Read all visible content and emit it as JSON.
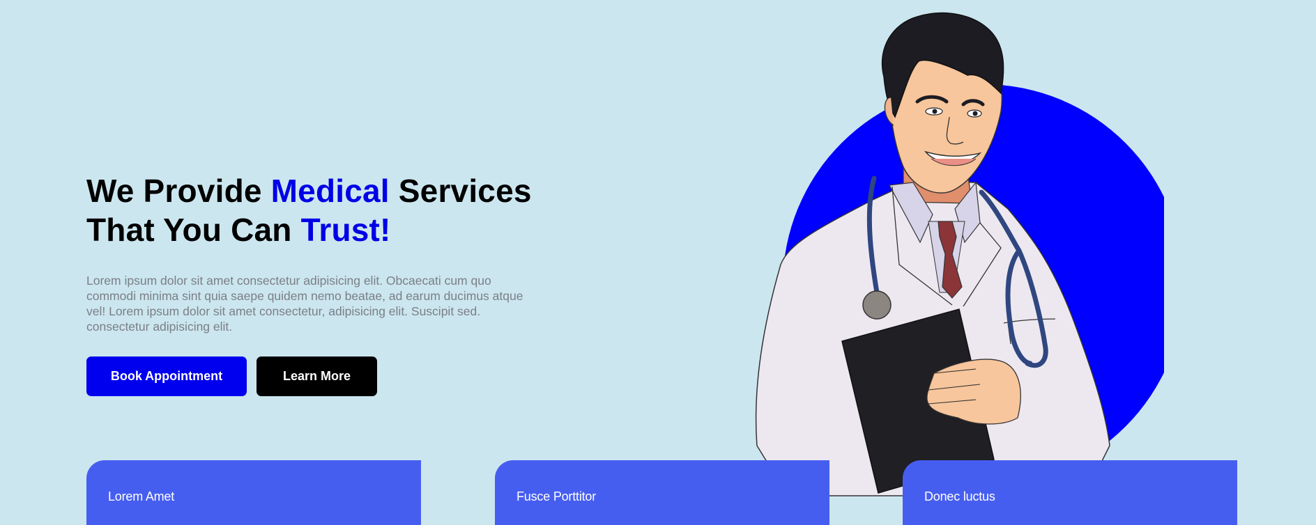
{
  "hero": {
    "title_part1": "We Provide ",
    "title_accent1": "Medical",
    "title_part2": " Services",
    "title_part3": "That You Can ",
    "title_accent2": "Trust!",
    "description": "Lorem ipsum dolor sit amet consectetur adipisicing elit. Obcaecati cum quo commodi minima sint quia saepe quidem nemo beatae, ad earum ducimus atque vel! Lorem ipsum dolor sit amet consectetur, adipisicing elit. Suscipit sed. consectetur adipisicing elit.",
    "primary_button": "Book Appointment",
    "secondary_button": "Learn More"
  },
  "illustration": {
    "name": "doctor-illustration",
    "circle_color": "#0000ff"
  },
  "cards": [
    {
      "title": "Lorem Amet"
    },
    {
      "title": "Fusce Porttitor"
    },
    {
      "title": "Donec luctus"
    }
  ],
  "colors": {
    "background": "#cce6ef",
    "accent": "#0000e6",
    "card": "#465ef0",
    "text_muted": "#7a7f86"
  }
}
